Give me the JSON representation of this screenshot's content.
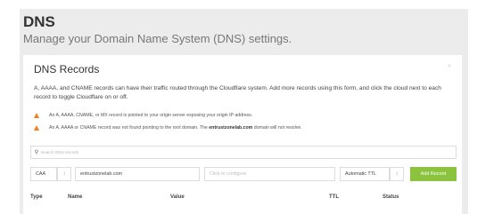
{
  "header": {
    "title": "DNS",
    "subtitle": "Manage your Domain Name System (DNS) settings."
  },
  "card": {
    "title": "DNS Records",
    "corner_mark": "»",
    "description": "A, AAAA, and CNAME records can have their traffic routed through the Cloudflare system. Add more records using this form, and click the cloud next to each record to toggle Cloudflare on or off.",
    "warnings": [
      {
        "text": "An A, AAAA, CNAME, or MX record is pointed to your origin server exposing your origin IP address."
      },
      {
        "text_before": "An A, AAAA or CNAME record was not found pointing to the root domain. The ",
        "domain": "entrustzonelab.com",
        "text_after": " domain will not resolve."
      }
    ]
  },
  "search": {
    "placeholder": "Search DNS records"
  },
  "form": {
    "type_value": "CAA",
    "stepper": "↕",
    "name_value": "entrustzonelab.com",
    "value_placeholder": "Click to configure",
    "ttl_value": "Automatic TTL",
    "add_label": "Add Record"
  },
  "table": {
    "headers": [
      "Type",
      "Name",
      "Value",
      "TTL",
      "Status"
    ]
  },
  "colors": {
    "panel_bg": "#ececec",
    "warning": "#f38020",
    "add_button": "#8bc33f"
  }
}
